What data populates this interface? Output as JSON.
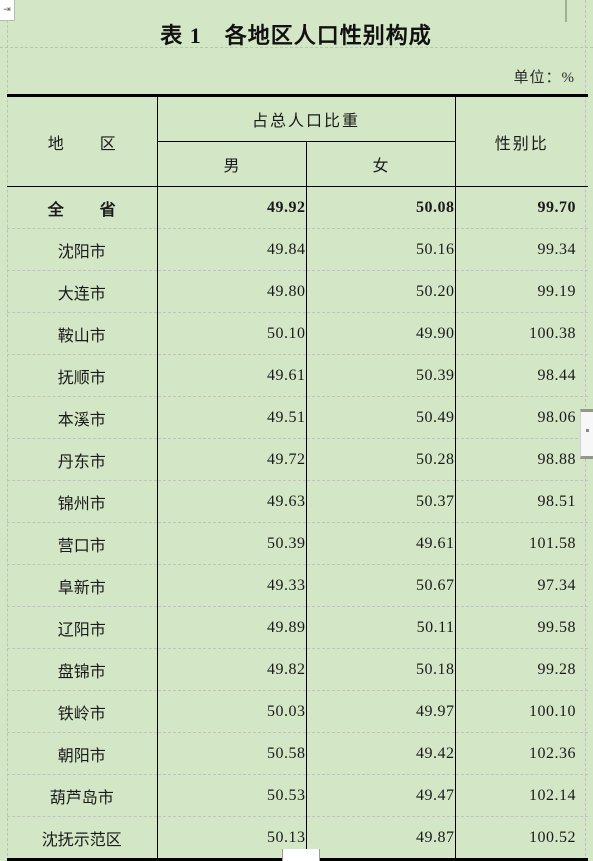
{
  "document": {
    "title": "表 1　各地区人口性别构成",
    "unit_note": "单位：%",
    "ruler_tab_glyph": "⇥"
  },
  "table": {
    "headers": {
      "region": "地　区",
      "share_group": "占总人口比重",
      "male": "男",
      "female": "女",
      "sex_ratio": "性别比"
    },
    "rows": [
      {
        "region": "全　省",
        "male": "49.92",
        "female": "50.08",
        "ratio": "99.70",
        "emphasis": true
      },
      {
        "region": "沈阳市",
        "male": "49.84",
        "female": "50.16",
        "ratio": "99.34",
        "emphasis": false
      },
      {
        "region": "大连市",
        "male": "49.80",
        "female": "50.20",
        "ratio": "99.19",
        "emphasis": false
      },
      {
        "region": "鞍山市",
        "male": "50.10",
        "female": "49.90",
        "ratio": "100.38",
        "emphasis": false
      },
      {
        "region": "抚顺市",
        "male": "49.61",
        "female": "50.39",
        "ratio": "98.44",
        "emphasis": false
      },
      {
        "region": "本溪市",
        "male": "49.51",
        "female": "50.49",
        "ratio": "98.06",
        "emphasis": false
      },
      {
        "region": "丹东市",
        "male": "49.72",
        "female": "50.28",
        "ratio": "98.88",
        "emphasis": false
      },
      {
        "region": "锦州市",
        "male": "49.63",
        "female": "50.37",
        "ratio": "98.51",
        "emphasis": false
      },
      {
        "region": "营口市",
        "male": "50.39",
        "female": "49.61",
        "ratio": "101.58",
        "emphasis": false
      },
      {
        "region": "阜新市",
        "male": "49.33",
        "female": "50.67",
        "ratio": "97.34",
        "emphasis": false
      },
      {
        "region": "辽阳市",
        "male": "49.89",
        "female": "50.11",
        "ratio": "99.58",
        "emphasis": false
      },
      {
        "region": "盘锦市",
        "male": "49.82",
        "female": "50.18",
        "ratio": "99.28",
        "emphasis": false
      },
      {
        "region": "铁岭市",
        "male": "50.03",
        "female": "49.97",
        "ratio": "100.10",
        "emphasis": false
      },
      {
        "region": "朝阳市",
        "male": "50.58",
        "female": "49.42",
        "ratio": "102.36",
        "emphasis": false
      },
      {
        "region": "葫芦岛市",
        "male": "50.53",
        "female": "49.47",
        "ratio": "102.14",
        "emphasis": false
      },
      {
        "region": "沈抚示范区",
        "male": "50.13",
        "female": "49.87",
        "ratio": "100.52",
        "emphasis": false
      }
    ]
  },
  "colors": {
    "page_background": "#d3e7c7",
    "rule": "#000000",
    "text": "#1a1a1a",
    "guide": "#b4c9a8"
  }
}
